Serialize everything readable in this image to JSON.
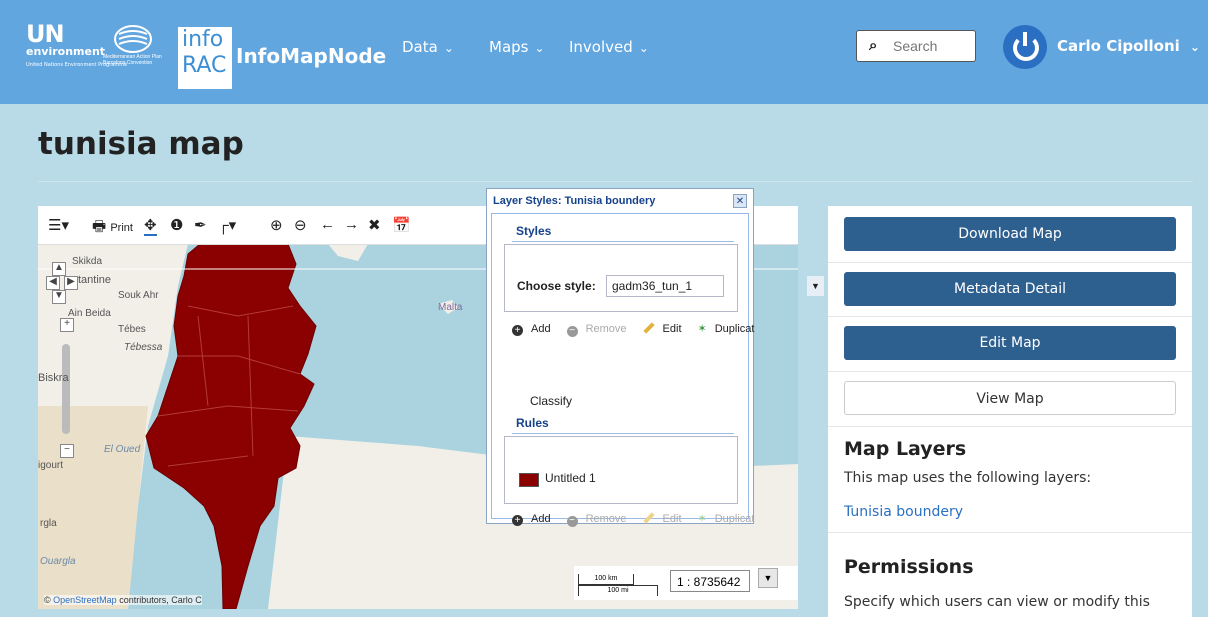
{
  "header": {
    "un_logo": {
      "big": "UN",
      "env": "environment",
      "sub": "United Nations Environment Programme"
    },
    "map_logo": {
      "sub": "Mediterranean Action Plan Barcelona Convention"
    },
    "info_logo": {
      "line1": "info",
      "line2": "RAC"
    },
    "brand": "InfoMapNode",
    "nav": [
      {
        "label": "Data"
      },
      {
        "label": "Maps"
      },
      {
        "label": "Involved"
      }
    ],
    "search_placeholder": "Search",
    "user": "Carlo Cipolloni",
    "colors": {
      "bar": "#62a6e0",
      "avatar": "#2a6fc1"
    }
  },
  "page": {
    "title": "tunisia map"
  },
  "map": {
    "toolbar": {
      "print": "Print"
    },
    "labels": [
      "Skikda",
      "tantine",
      "Souk Ahr",
      "Ain Beida",
      "Tébes",
      "Tébessa",
      "Biskra",
      "El Oued",
      "Malta",
      "Ouargla",
      "rgla",
      "igourt"
    ],
    "attribution": {
      "link": "OpenStreetMap",
      "text": " contributors, Carlo C"
    },
    "scale": {
      "km": "100 km",
      "mi": "100 mi",
      "ratio": "1 : 8735642"
    },
    "fill_color": "#8b0000"
  },
  "dialog": {
    "title": "Layer Styles: Tunisia boundery",
    "styles_header": "Styles",
    "choose_label": "Choose style:",
    "choose_value": "gadm36_tun_1",
    "actions": {
      "add": "Add",
      "remove": "Remove",
      "edit": "Edit",
      "duplicate": "Duplicat"
    },
    "classify": "Classify",
    "rules_header": "Rules",
    "rule_name": "Untitled 1"
  },
  "panel": {
    "download": "Download Map",
    "metadata": "Metadata Detail",
    "edit": "Edit Map",
    "view": "View Map",
    "layers_title": "Map Layers",
    "layers_text": "This map uses the following layers:",
    "layer_link": "Tunisia boundery",
    "perm_title": "Permissions",
    "perm_text": "Specify which users can view or modify this"
  }
}
